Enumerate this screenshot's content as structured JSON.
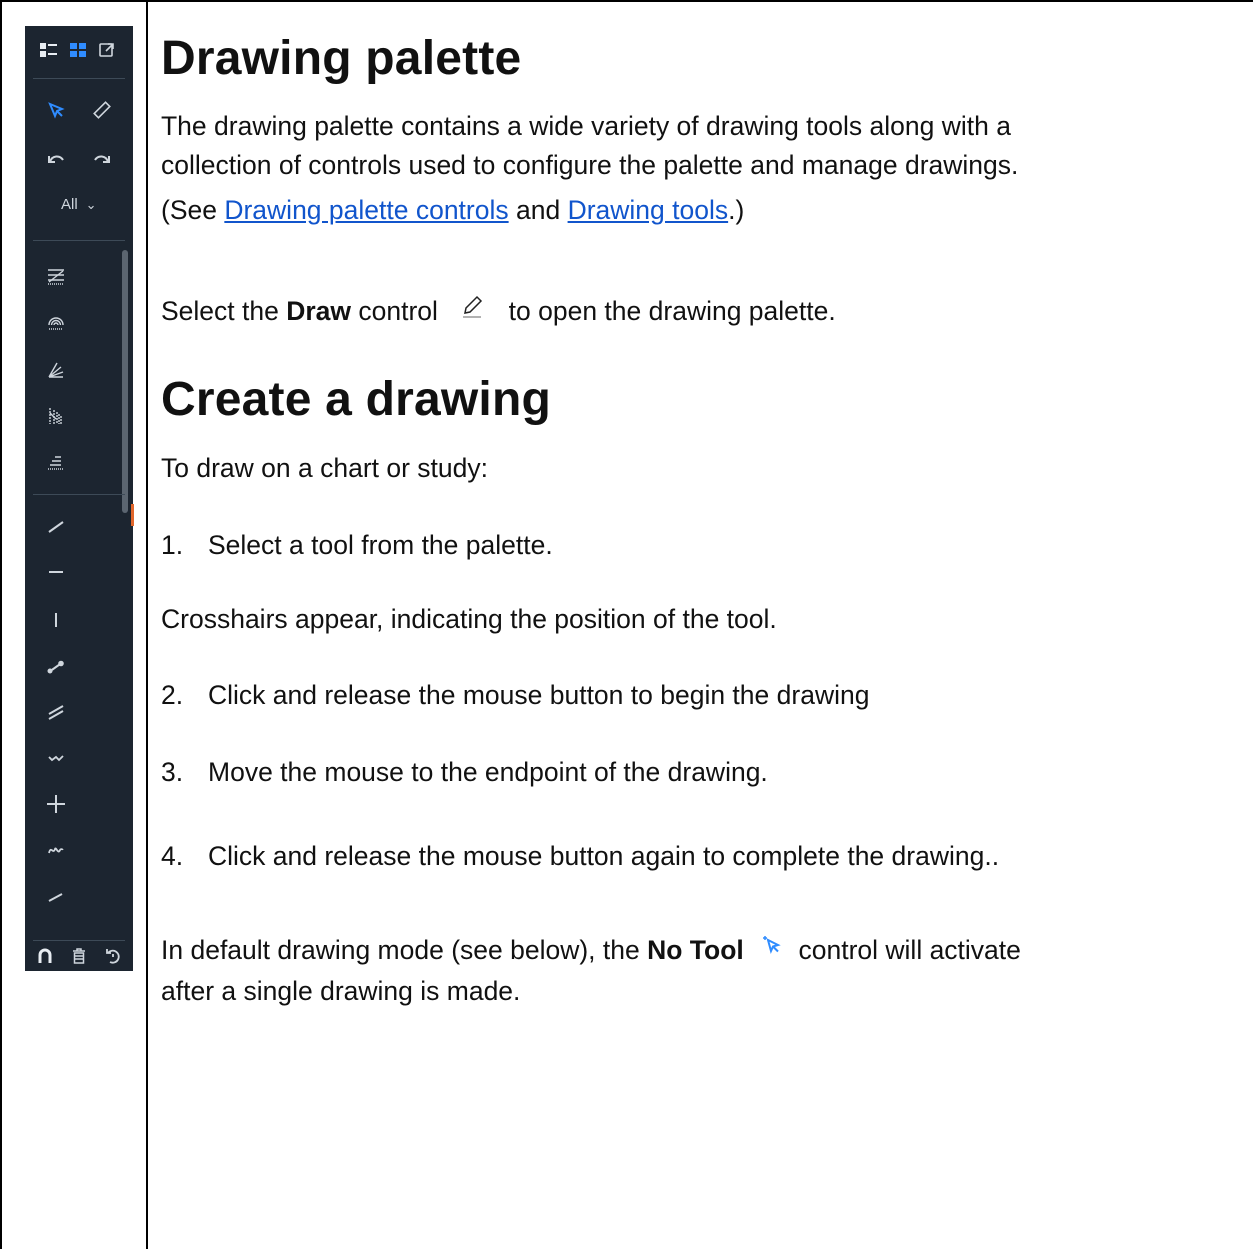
{
  "section1": {
    "title": "Drawing palette",
    "intro_line1": "The drawing palette contains a wide variety of drawing tools along with a",
    "intro_line2": "collection of controls used to configure the palette and manage drawings.",
    "see_prefix": "(See ",
    "link_controls": "Drawing palette controls",
    "see_and": " and ",
    "link_tools": "Drawing tools",
    "see_suffix": ".)",
    "select_prefix": "Select the ",
    "select_bold": "Draw",
    "select_mid": " control ",
    "select_suffix": " to open the drawing palette.",
    "draw_icon": "pencil-icon"
  },
  "section2": {
    "title": "Create a drawing",
    "intro": "To draw on a chart or study:",
    "step1_num": "1.",
    "step1": "Select a tool from the palette.",
    "crosshairs": "Crosshairs appear, indicating the position of the tool.",
    "step2_num": "2.",
    "step2": "Click and release the mouse button to begin the drawing",
    "step3_num": "3.",
    "step3": "Move the mouse to the endpoint of the drawing.",
    "step4_num": "4.",
    "step4": "Click and release the mouse button again to complete the drawing..",
    "mode_prefix": "In default drawing mode (see below), the ",
    "mode_bold": "No Tool",
    "mode_suffix": " control will activate",
    "mode_line2": "after a single drawing is made.",
    "no_tool_icon": "cursor-arrow-icon"
  },
  "palette": {
    "filter_label": "All",
    "colors": {
      "background": "#1c2530",
      "icon": "#cfd6dd",
      "active": "#2f8cff",
      "accent": "#e0662b"
    },
    "top_icons": [
      "list-view-icon",
      "grid-view-icon",
      "detach-icon"
    ],
    "tools": [
      "cursor-icon",
      "ruler-icon",
      "undo-icon",
      "redo-icon"
    ],
    "favorites": [
      "fib-retracement-icon",
      "fib-arc-icon",
      "gann-fan-icon",
      "fib-timezone-icon",
      "speed-lines-icon"
    ],
    "lines": [
      "line-icon",
      "horizontal-line-icon",
      "vertical-line-icon",
      "ray-icon",
      "channel-icon",
      "wave-icon",
      "crosshair-icon",
      "freeform-icon",
      "segment-icon"
    ],
    "bottom": [
      "magnet-icon",
      "trash-icon",
      "reset-icon"
    ]
  }
}
